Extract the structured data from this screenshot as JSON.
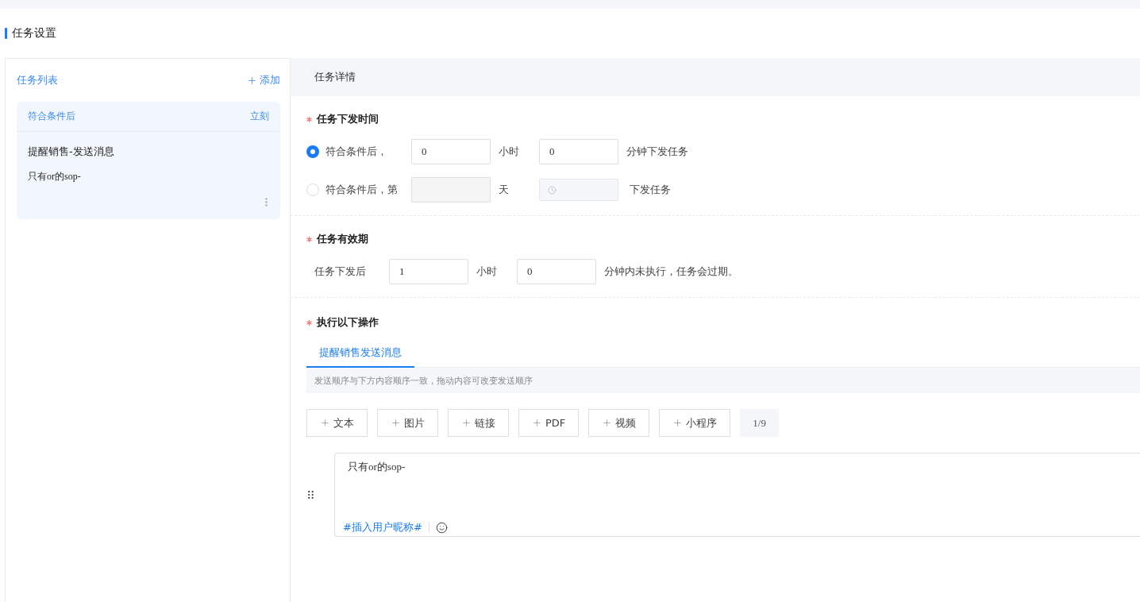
{
  "page_title": "任务设置",
  "task_list": {
    "title": "任务列表",
    "add_button": "添加",
    "groups": [
      {
        "trigger": "符合条件后",
        "timing": "立刻",
        "tasks": [
          {
            "title": "提醒销售-发送消息",
            "content": "只有or的sop-"
          }
        ]
      }
    ]
  },
  "detail": {
    "title": "任务详情",
    "send_time": {
      "label": "任务下发时间",
      "required": true,
      "options": [
        {
          "kind": "hours",
          "selected": true,
          "prefix": "符合条件后，",
          "hours": "0",
          "hours_unit": "小时",
          "minutes": "0",
          "suffix": "分钟下发任务"
        },
        {
          "kind": "days",
          "selected": false,
          "prefix": "符合条件后，第",
          "day_unit": "天",
          "suffix": "下发任务"
        }
      ]
    },
    "validity": {
      "label": "任务有效期",
      "required": true,
      "prefix": "任务下发后",
      "hours": "1",
      "hours_unit": "小时",
      "minutes": "0",
      "suffix": "分钟内未执行，任务会过期。"
    },
    "actions": {
      "label": "执行以下操作",
      "required": true,
      "tabs": [
        {
          "label": "提醒销售发送消息",
          "selected": true
        }
      ],
      "hint": "发送顺序与下方内容顺序一致，拖动内容可改变发送顺序",
      "add_buttons": [
        "文本",
        "图片",
        "链接",
        "PDF",
        "视频",
        "小程序"
      ],
      "counter": "1/9",
      "message": {
        "text": "只有or的sop-",
        "insert_link": "#插入用户昵称#"
      }
    }
  }
}
